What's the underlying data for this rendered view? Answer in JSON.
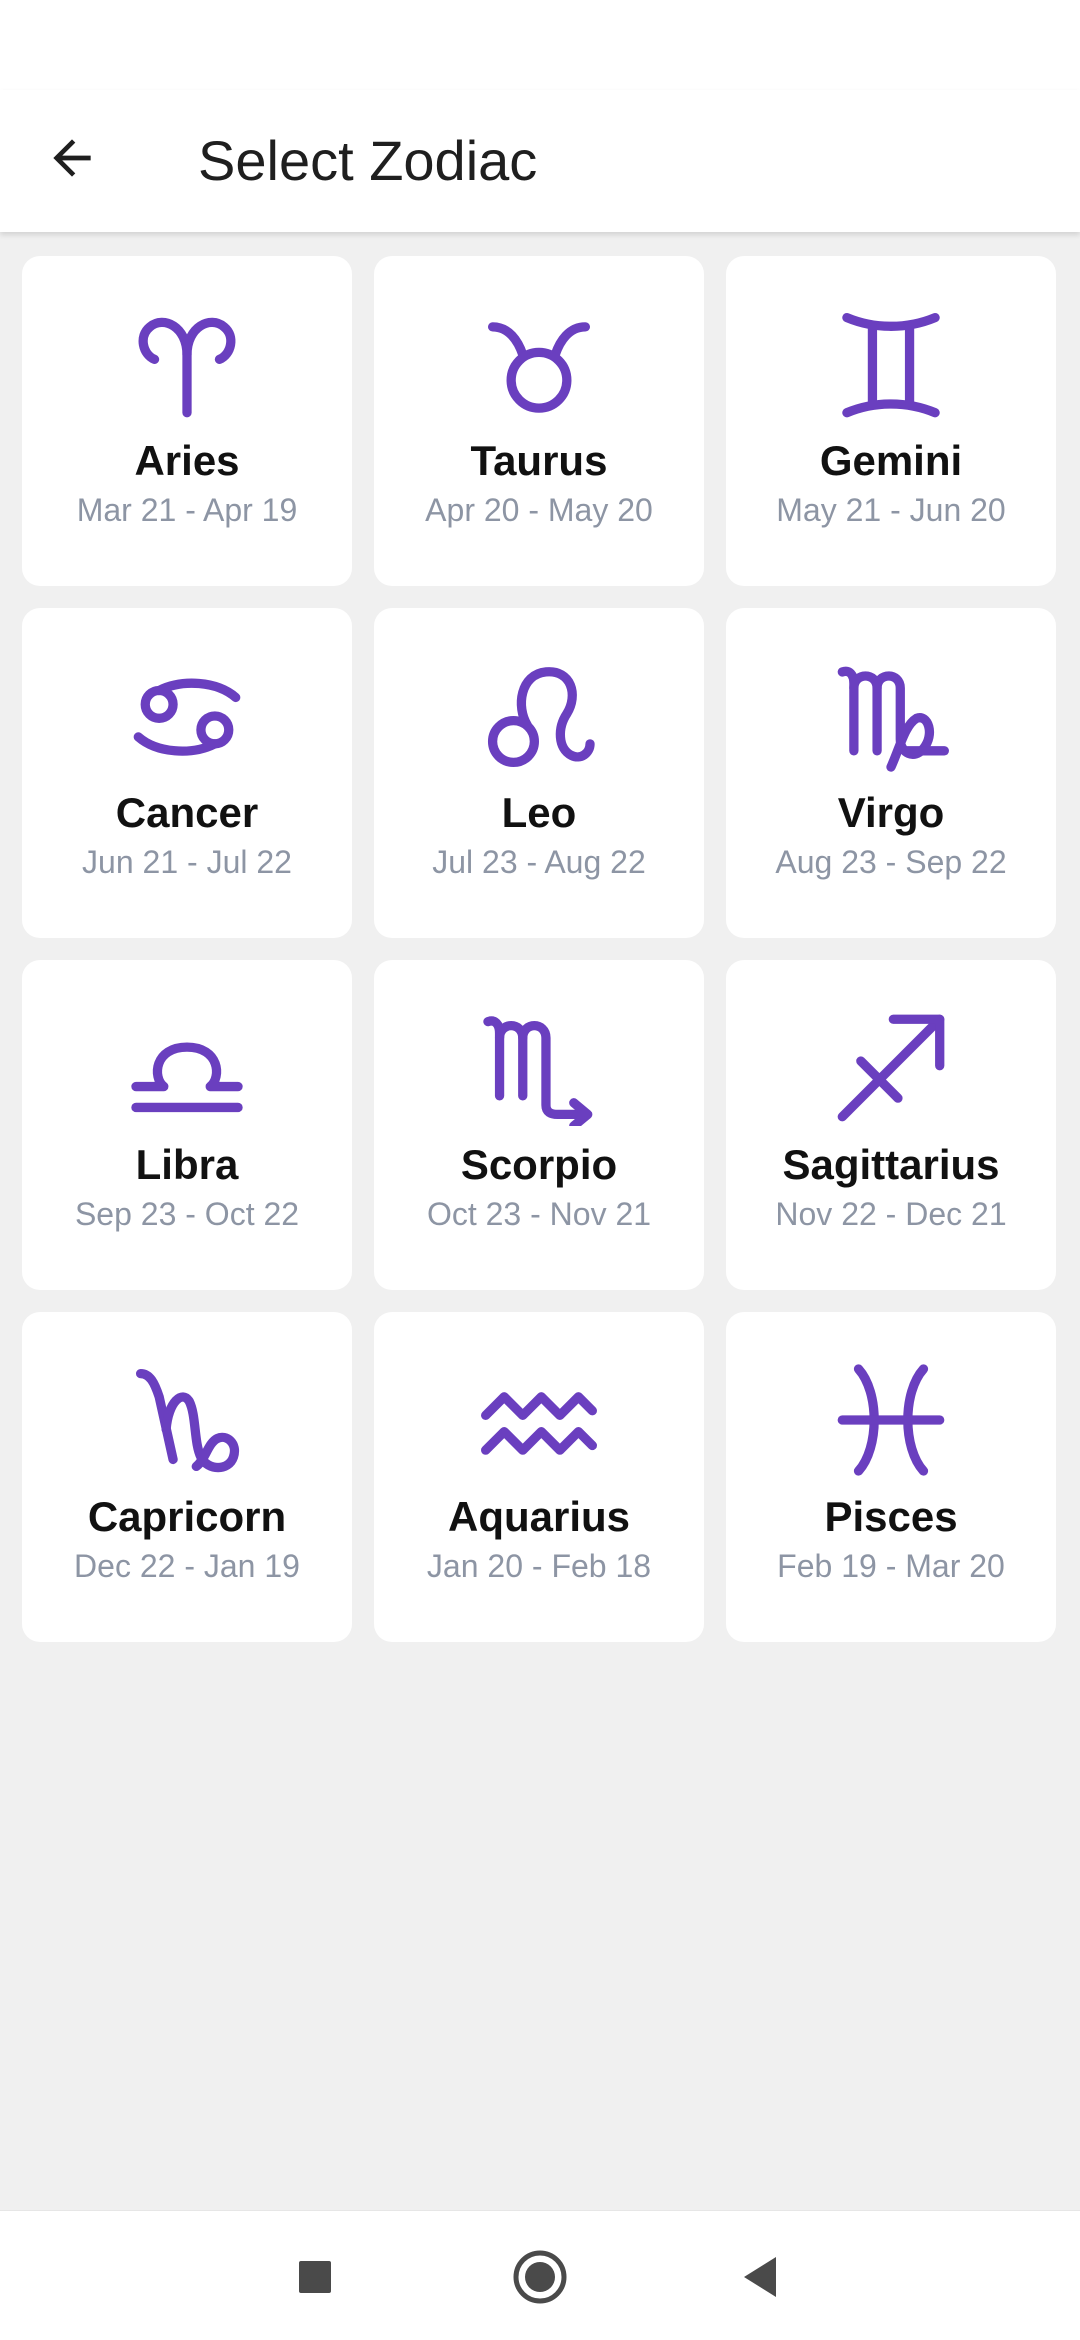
{
  "app_bar": {
    "title": "Select Zodiac",
    "back_icon": "arrow-left-icon"
  },
  "colors": {
    "accent": "#6a3fbf",
    "background": "#f0f0f0",
    "card": "#ffffff",
    "date_text": "#8d95a4"
  },
  "signs": [
    {
      "name": "Aries",
      "dates": "Mar 21 - Apr 19",
      "icon": "aries-icon"
    },
    {
      "name": "Taurus",
      "dates": "Apr 20 - May 20",
      "icon": "taurus-icon"
    },
    {
      "name": "Gemini",
      "dates": "May 21 - Jun 20",
      "icon": "gemini-icon"
    },
    {
      "name": "Cancer",
      "dates": "Jun 21 - Jul 22",
      "icon": "cancer-icon"
    },
    {
      "name": "Leo",
      "dates": "Jul 23 - Aug 22",
      "icon": "leo-icon"
    },
    {
      "name": "Virgo",
      "dates": "Aug 23 - Sep 22",
      "icon": "virgo-icon"
    },
    {
      "name": "Libra",
      "dates": "Sep 23 - Oct 22",
      "icon": "libra-icon"
    },
    {
      "name": "Scorpio",
      "dates": "Oct 23 - Nov 21",
      "icon": "scorpio-icon"
    },
    {
      "name": "Sagittarius",
      "dates": "Nov 22 - Dec 21",
      "icon": "sagittarius-icon"
    },
    {
      "name": "Capricorn",
      "dates": "Dec 22 - Jan 19",
      "icon": "capricorn-icon"
    },
    {
      "name": "Aquarius",
      "dates": "Jan 20 - Feb 18",
      "icon": "aquarius-icon"
    },
    {
      "name": "Pisces",
      "dates": "Feb 19 - Mar 20",
      "icon": "pisces-icon"
    }
  ],
  "nav_bar": {
    "recents_icon": "square-icon",
    "home_icon": "circle-icon",
    "back_icon": "triangle-back-icon"
  }
}
